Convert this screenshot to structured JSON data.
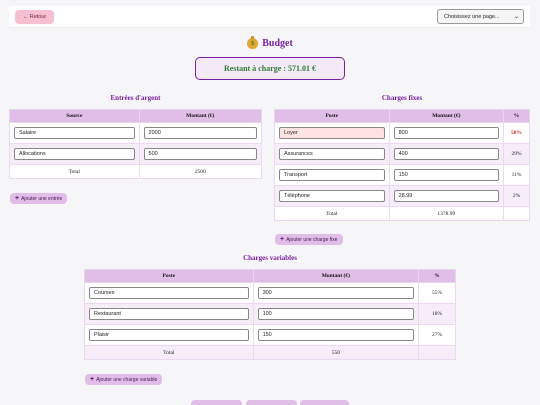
{
  "header": {
    "back_label": "← Retour",
    "select_value": "Choisissez une page...",
    "select_options": [
      "Choisissez une page..."
    ]
  },
  "title": "Budget",
  "remaining": "Restant à charge : 571.01 €",
  "entrees": {
    "title": "Entrées d'argent",
    "headers": [
      "Source",
      "Montant (€)"
    ],
    "rows": [
      {
        "source": "Salaire",
        "amount": "2000"
      },
      {
        "source": "Allocations",
        "amount": "500"
      }
    ],
    "total_label": "Total",
    "total": "2500",
    "add_label": "Ajouter une entrée"
  },
  "fixes": {
    "title": "Charges fixes",
    "headers": [
      "Poste",
      "Montant (€)",
      "%"
    ],
    "rows": [
      {
        "poste": "Loyer",
        "amount": "800",
        "pct": "58%"
      },
      {
        "poste": "Assurances",
        "amount": "400",
        "pct": "29%"
      },
      {
        "poste": "Transport",
        "amount": "150",
        "pct": "11%"
      },
      {
        "poste": "Téléphone",
        "amount": "28.99",
        "pct": "2%"
      }
    ],
    "total_label": "Total",
    "total": "1378.99",
    "add_label": "Ajouter une charge fixe"
  },
  "variables": {
    "title": "Charges variables",
    "headers": [
      "Poste",
      "Montant (€)",
      "%"
    ],
    "rows": [
      {
        "poste": "Courses",
        "amount": "300",
        "pct": "55%"
      },
      {
        "poste": "Restaurant",
        "amount": "100",
        "pct": "18%"
      },
      {
        "poste": "Plaisir",
        "amount": "150",
        "pct": "27%"
      }
    ],
    "total_label": "Total",
    "total": "550",
    "add_label": "Ajouter une charge variable"
  },
  "colors": {
    "accent": "#7b1fa2",
    "header_bg": "#e1bee7",
    "positive": "#2e7d32",
    "warning": "#c62828",
    "back_btn": "#f7c0d0"
  }
}
